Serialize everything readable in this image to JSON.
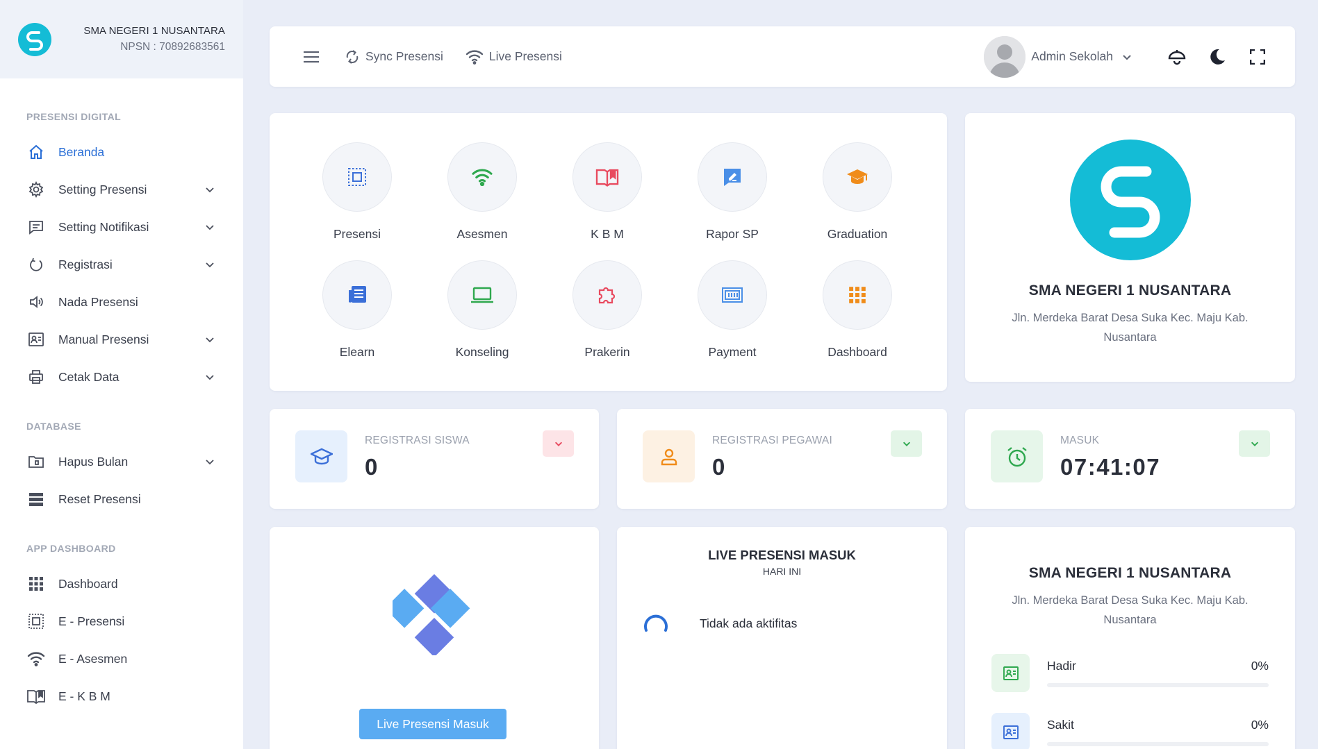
{
  "brand": {
    "name": "SMA NEGERI 1 NUSANTARA",
    "npsn": "NPSN : 70892683561"
  },
  "sidebar": {
    "sections": [
      {
        "title": "PRESENSI DIGITAL"
      },
      {
        "title": "DATABASE"
      },
      {
        "title": "APP DASHBOARD"
      }
    ],
    "items": [
      {
        "label": "Beranda",
        "icon": "home-icon"
      },
      {
        "label": "Setting Presensi",
        "icon": "gear-icon"
      },
      {
        "label": "Setting Notifikasi",
        "icon": "message-icon"
      },
      {
        "label": "Registrasi",
        "icon": "power-icon"
      },
      {
        "label": "Nada Presensi",
        "icon": "speaker-icon"
      },
      {
        "label": "Manual Presensi",
        "icon": "id-card-icon"
      },
      {
        "label": "Cetak Data",
        "icon": "printer-icon"
      },
      {
        "label": "Hapus Bulan",
        "icon": "folder-icon"
      },
      {
        "label": "Reset Presensi",
        "icon": "server-icon"
      },
      {
        "label": "Dashboard",
        "icon": "grid-icon"
      },
      {
        "label": "E - Presensi",
        "icon": "scan-icon"
      },
      {
        "label": "E - Asesmen",
        "icon": "wifi-icon"
      },
      {
        "label": "E - K B M",
        "icon": "book-icon"
      }
    ]
  },
  "topbar": {
    "sync": "Sync Presensi",
    "live": "Live Presensi",
    "user": "Admin Sekolah"
  },
  "menu": [
    {
      "label": "Presensi",
      "icon": "scan-icon",
      "color": "#3b6fd8"
    },
    {
      "label": "Asesmen",
      "icon": "wifi-icon",
      "color": "#2fa84f"
    },
    {
      "label": "K B M",
      "icon": "book-icon",
      "color": "#e84a5f"
    },
    {
      "label": "Rapor SP",
      "icon": "report-icon",
      "color": "#4a8fe7"
    },
    {
      "label": "Graduation",
      "icon": "graduation-cap-icon",
      "color": "#f08c1a"
    },
    {
      "label": "Elearn",
      "icon": "newspaper-icon",
      "color": "#3b6fd8"
    },
    {
      "label": "Konseling",
      "icon": "laptop-icon",
      "color": "#2fa84f"
    },
    {
      "label": "Prakerin",
      "icon": "puzzle-icon",
      "color": "#e84a5f"
    },
    {
      "label": "Payment",
      "icon": "payment-icon",
      "color": "#4a8fe7"
    },
    {
      "label": "Dashboard",
      "icon": "grid-icon",
      "color": "#f08c1a"
    }
  ],
  "school": {
    "name": "SMA NEGERI 1 NUSANTARA",
    "address": "Jln. Merdeka Barat Desa Suka Kec. Maju Kab. Nusantara"
  },
  "stats": [
    {
      "label": "REGISTRASI SISWA",
      "value": "0"
    },
    {
      "label": "REGISTRASI PEGAWAI",
      "value": "0"
    },
    {
      "label": "MASUK",
      "value": "07:41:07"
    }
  ],
  "live_panel": {
    "button": "Live Presensi Masuk"
  },
  "activity": {
    "title": "LIVE PRESENSI MASUK",
    "subtitle": "HARI INI",
    "empty": "Tidak ada aktifitas"
  },
  "attendance": {
    "rows": [
      {
        "label": "Hadir",
        "percent": "0%",
        "fill": 0
      },
      {
        "label": "Sakit",
        "percent": "0%",
        "fill": 0
      }
    ]
  },
  "colors": {
    "accent": "#2b6fd6",
    "brand": "#14bcd6",
    "success": "#34b356",
    "danger": "#e84a5f",
    "warning": "#f08c1a"
  }
}
